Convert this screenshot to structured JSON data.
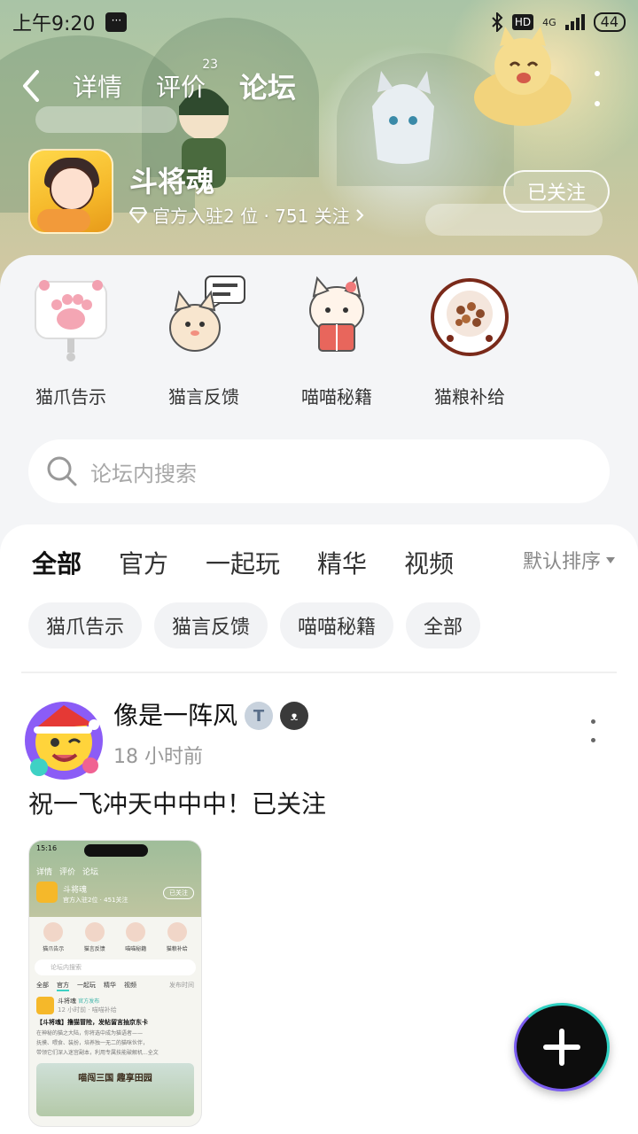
{
  "status_bar": {
    "time": "上午9:20",
    "hd": "HD",
    "network": "4G",
    "battery": "44"
  },
  "nav": {
    "tabs": [
      {
        "label": "详情",
        "count": ""
      },
      {
        "label": "评价",
        "count": "23"
      },
      {
        "label": "论坛",
        "count": ""
      }
    ],
    "active_tab": "论坛"
  },
  "game": {
    "name": "斗将魂",
    "meta": "官方入驻2 位 · 751 关注",
    "follow_label": "已关注"
  },
  "shortcuts": [
    {
      "label": "猫爪告示",
      "icon": "paw-sign-icon"
    },
    {
      "label": "猫言反馈",
      "icon": "cat-feedback-icon"
    },
    {
      "label": "喵喵秘籍",
      "icon": "cat-book-icon"
    },
    {
      "label": "猫粮补给",
      "icon": "cat-food-bowl-icon"
    }
  ],
  "search": {
    "placeholder": "论坛内搜索"
  },
  "filter_tabs": [
    "全部",
    "官方",
    "一起玩",
    "精华",
    "视频"
  ],
  "active_filter": "全部",
  "sort_label": "默认排序",
  "chips": [
    "猫爪告示",
    "猫言反馈",
    "喵喵秘籍",
    "全部"
  ],
  "post": {
    "author": "像是一阵风",
    "time": "18 小时前",
    "text": "祝一飞冲天中中中！已关注",
    "thumbnail": {
      "time": "15:16",
      "tabs": [
        "详情",
        "评价",
        "论坛"
      ],
      "game_name": "斗将魂",
      "game_meta": "官方入驻2位 · 451关注",
      "follow": "已关注",
      "shortcuts": [
        "猫爪告示",
        "猫言反馈",
        "喵喵秘籍",
        "猫粮补给"
      ],
      "search": "论坛内搜索",
      "ftabs": [
        "全部",
        "官方",
        "一起玩",
        "精华",
        "视频"
      ],
      "sort": "发布时间",
      "post_author": "斗将魂",
      "post_tag": "官方发布",
      "post_time": "12 小时前 · 喵喵补给",
      "post_title": "【斗将魂】撸猫冒险，发帖留言抽京东卡",
      "post_lines": [
        "在神秘的猫之大陆，你将选中成为猫语者——",
        "抚摸、喂食、装扮，培养独一无二的猫咪伙伴，",
        "带领它们深入迷宫副本，利用专属技能破解机...全文"
      ],
      "cover_text": "喵闯三国 趣享田园"
    }
  },
  "colors": {
    "accent": "#3ed1c4",
    "card_bg": "#f4f5f7",
    "fab_bg": "#0d0d0d"
  }
}
